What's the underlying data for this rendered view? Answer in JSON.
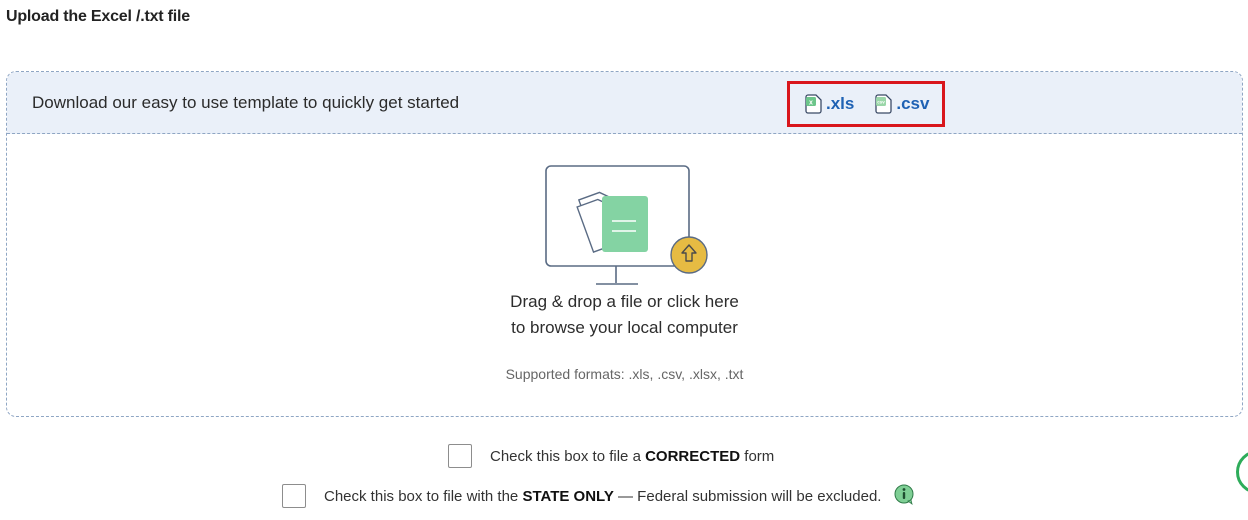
{
  "page": {
    "title": "Upload the Excel /.txt file"
  },
  "template_bar": {
    "text": "Download our easy to use template to quickly get started",
    "links": [
      {
        "label": ".xls",
        "icon": "excel-file-icon"
      },
      {
        "label": ".csv",
        "icon": "csv-file-icon"
      }
    ],
    "highlight_color": "#d9161c",
    "link_color": "#1f62b4"
  },
  "drop_zone": {
    "line1": "Drag & drop a file or click here",
    "line2": "to browse your local computer",
    "supported": "Supported formats: .xls, .csv, .xlsx, .txt",
    "illustration_icon": "monitor-upload-icon"
  },
  "options": {
    "corrected": {
      "prefix": "Check this box to file a",
      "bold": "CORRECTED",
      "suffix": "form",
      "checked": false
    },
    "state_only": {
      "prefix": "Check this box to file with the",
      "bold": "STATE ONLY",
      "suffix": "— Federal submission will be excluded.",
      "checked": false,
      "info_icon": "info-icon"
    }
  },
  "colors": {
    "accent_green": "#2eac5a",
    "bar_background": "#eaf0f9",
    "upload_badge": "#e6bb43"
  }
}
